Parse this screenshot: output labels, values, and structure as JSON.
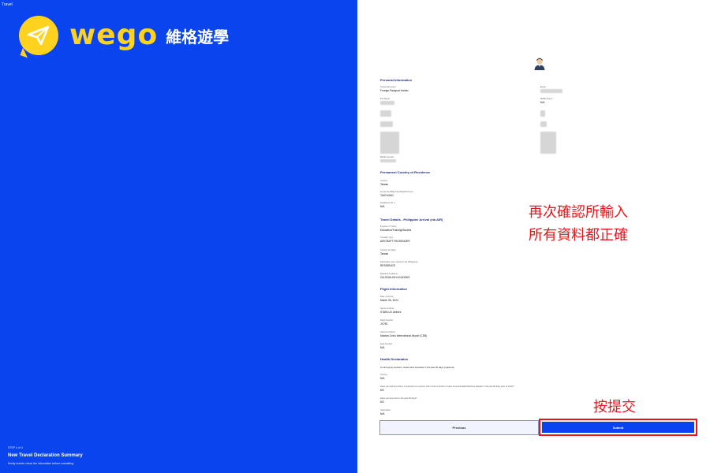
{
  "brand": {
    "tiny_label": "Travel",
    "logo_word": "wego",
    "logo_cn": "維格遊學",
    "accent_color": "#0a44ef",
    "logo_color": "#ffd21f",
    "icon": "paper-plane-icon"
  },
  "left_panel": {
    "step": "STEP 4 of 4",
    "title": "New Travel Declaration Summary",
    "subtitle": "Kindly double check the information before submitting."
  },
  "form": {
    "personal": {
      "heading": "Personal Information",
      "travel_doc_label": "Travel Document",
      "travel_doc_value": "Foreign Passport Holder",
      "email_label": "Email",
      "full_name_label": "Full Name",
      "middle_name_label": "Middle Name",
      "middle_name_value": "N/A",
      "mobile_label": "Mobile Number"
    },
    "residence": {
      "heading": "Permanent Country of Residence",
      "country_label": "Country",
      "country_value": "Taiwan",
      "city_label": "House No./Bldg./City/State/Province",
      "city_value": "TAICHUNG",
      "phone_label": "Telephone No. 1",
      "phone_value": "N/A"
    },
    "travel": {
      "heading": "Travel Details - Philippine Arrival (via AIR)",
      "purpose_label": "Purpose of Travel",
      "purpose_value": "Education/Training/Studies",
      "traveller_type_label": "Traveller Type",
      "traveller_type_value": "AIRCRAFT PASSENGER",
      "origin_label": "Country of Origin",
      "origin_value": "Taiwan",
      "destination_label": "Destination upon arrival in the Philippines",
      "destination_value": "RESIDENCE",
      "residence_address_label": "Residence Address",
      "residence_address_value": "CIA ENGLISH ACADEMY"
    },
    "flight": {
      "heading": "Flight Information",
      "arrival_date_label": "Date of Arrival",
      "arrival_date_value": "March 06, 2024",
      "airline_label": "Name of Airline",
      "airline_value": "STARLUX Airlines",
      "flight_no_label": "Flight Number",
      "flight_no_value": "JX782",
      "airport_label": "Airport of Arrival",
      "airport_value": "Mactan-Cebu International Airport (CEB)",
      "seat_label": "Seat Number",
      "seat_value": "N/A"
    },
    "health": {
      "heading": "Health Declaration",
      "countries_question": "Country(ies) worked, visited and transited in the last 30 days (optional)",
      "countries_sub_label": "Country",
      "countries_value": "N/A",
      "exposure_question": "Have you had any history of exposure to a person who is sick or known to have communicable/infectious disease in the past 30 days prior to travel?",
      "exposure_value": "NO",
      "sick_question": "Have you been sick in the past 30 days?",
      "sick_value": "NO",
      "vaccine_label": "Vaccination",
      "vaccine_value": "N/A"
    }
  },
  "buttons": {
    "previous": "Previous",
    "submit": "Submit"
  },
  "annotations": {
    "confirm_line1": "再次確認所輸入",
    "confirm_line2": "所有資料都正確",
    "submit_hint": "按提交",
    "color": "#e8161c"
  }
}
